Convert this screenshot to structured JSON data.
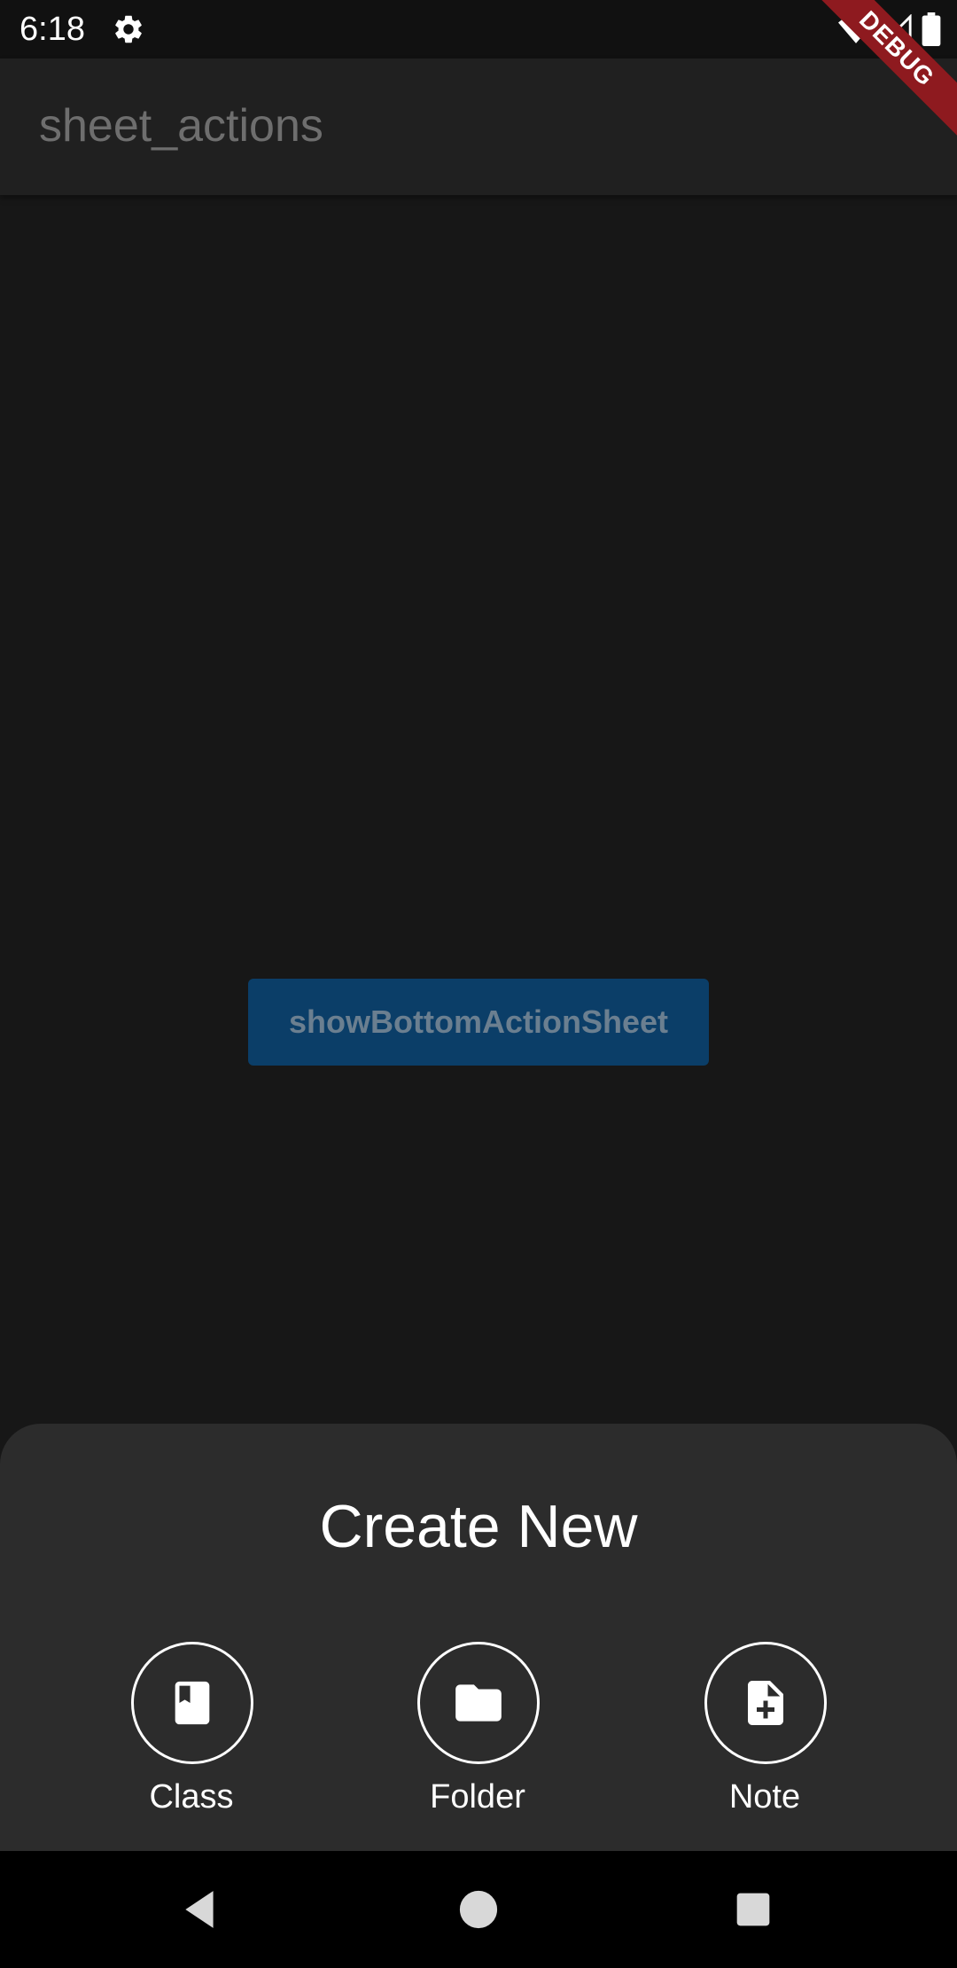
{
  "status_bar": {
    "time": "6:18",
    "icons": [
      "gear-icon",
      "wifi-icon",
      "signal-icon",
      "battery-icon"
    ]
  },
  "debug_banner": {
    "label": "DEBUG"
  },
  "app_bar": {
    "title": "sheet_actions"
  },
  "main": {
    "button_label": "showBottomActionSheet"
  },
  "bottom_sheet": {
    "title": "Create New",
    "actions": [
      {
        "label": "Class",
        "icon": "class-book-icon"
      },
      {
        "label": "Folder",
        "icon": "folder-icon"
      },
      {
        "label": "Note",
        "icon": "note-add-icon"
      }
    ]
  },
  "nav_bar": {
    "buttons": [
      "back-icon",
      "home-icon",
      "recents-icon"
    ]
  },
  "colors": {
    "background": "#171717",
    "app_bar": "#202020",
    "sheet": "#2c2c2c",
    "button": "#0b3e68",
    "debug_ribbon": "#8e1a1f"
  }
}
